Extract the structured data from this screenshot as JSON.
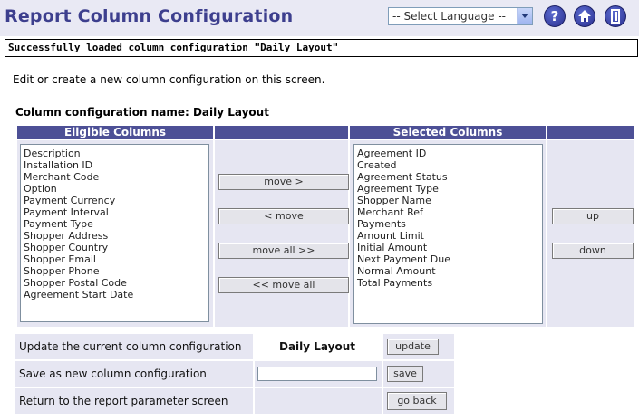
{
  "header": {
    "title": "Report Column Configuration",
    "language_select": "-- Select Language --",
    "icons": [
      "help-icon",
      "home-icon",
      "exit-icon"
    ]
  },
  "status_message": "Successfully loaded column configuration \"Daily Layout\"",
  "instruction": "Edit or create a new column configuration on this screen.",
  "config_name_label": "Column configuration name: Daily Layout",
  "eligible": {
    "header": "Eligible Columns",
    "items": [
      "Description",
      "Installation ID",
      "Merchant Code",
      "Option",
      "Payment Currency",
      "Payment Interval",
      "Payment Type",
      "Shopper Address",
      "Shopper Country",
      "Shopper Email",
      "Shopper Phone",
      "Shopper Postal Code",
      "Agreement Start Date"
    ]
  },
  "selected": {
    "header": "Selected Columns",
    "items": [
      "Agreement ID",
      "Created",
      "Agreement Status",
      "Agreement Type",
      "Shopper Name",
      "Merchant Ref",
      "Payments",
      "Amount Limit",
      "Initial Amount",
      "Next Payment Due",
      "Normal Amount",
      "Total Payments"
    ]
  },
  "move_buttons": {
    "move": "move >",
    "unmove": "< move",
    "move_all": "move all >>",
    "unmove_all": "<< move all"
  },
  "order_buttons": {
    "up": "up",
    "down": "down"
  },
  "form": {
    "update_label": "Update the current column configuration",
    "update_value": "Daily Layout",
    "update_button": "update",
    "save_label": "Save as new column configuration",
    "save_value": "",
    "save_button": "save",
    "back_label": "Return to the report parameter screen",
    "back_button": "go back"
  },
  "colors": {
    "title": "#3d3f8e",
    "header_bg": "#4d5096",
    "panel_bg": "#e6e6f2",
    "topbar_bg": "#e9e9f4"
  }
}
